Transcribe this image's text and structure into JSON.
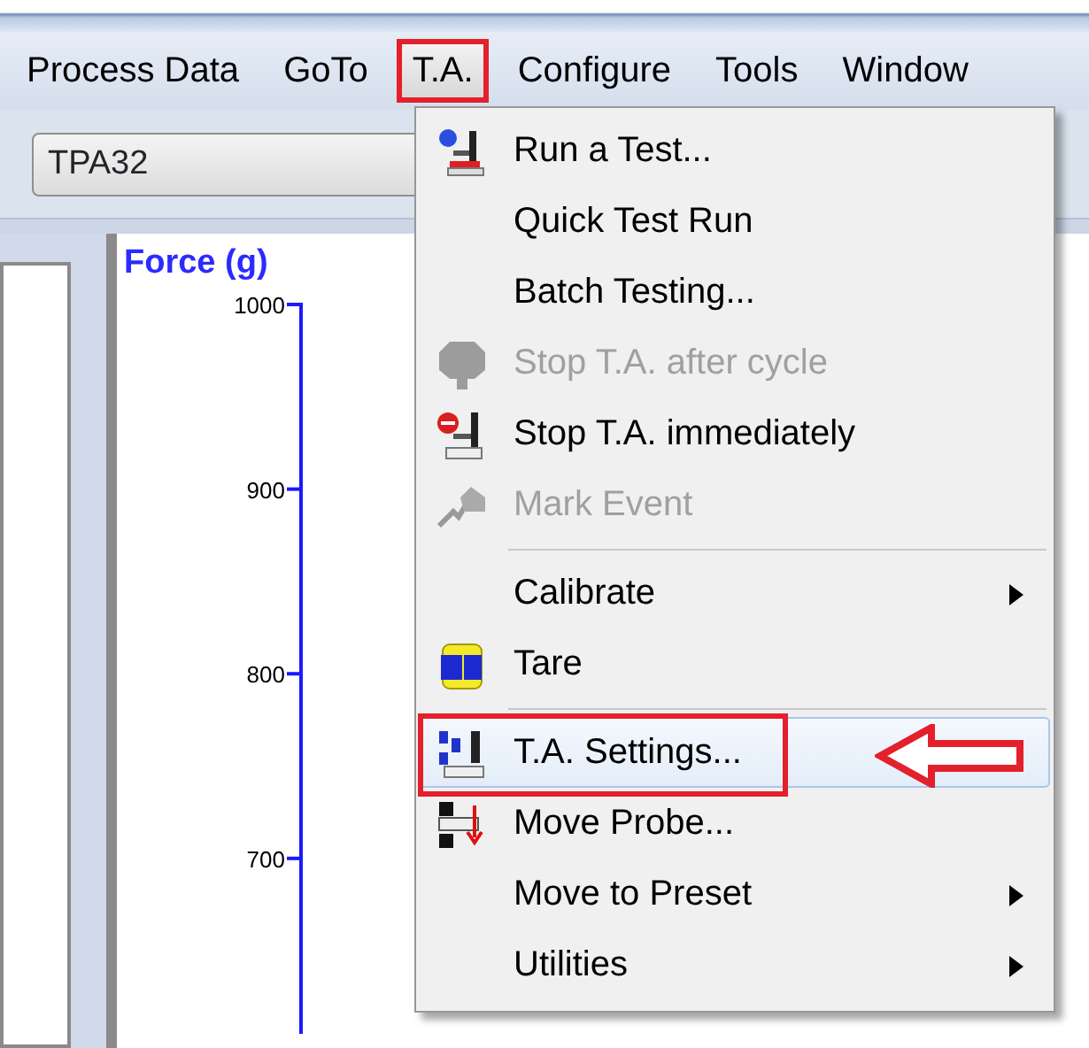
{
  "menu_bar": [
    {
      "label": "Process Data",
      "selected": false,
      "annotated": false
    },
    {
      "label": "GoTo",
      "selected": false,
      "annotated": false
    },
    {
      "label": "T.A.",
      "selected": true,
      "annotated": true
    },
    {
      "label": "Configure",
      "selected": false,
      "annotated": false
    },
    {
      "label": "Tools",
      "selected": false,
      "annotated": false
    },
    {
      "label": "Window",
      "selected": false,
      "annotated": false
    }
  ],
  "toolbar": {
    "combo_value": "TPA32"
  },
  "chart": {
    "axis_title": "Force (g)",
    "tick_labels": [
      "1000",
      "900",
      "800",
      "700"
    ]
  },
  "menu": {
    "entries": [
      {
        "kind": "item",
        "label": "Run a Test...",
        "disabled": false,
        "selected": false,
        "submenu": false,
        "annotated": false,
        "arrow": false
      },
      {
        "kind": "item",
        "label": "Quick Test Run",
        "disabled": false,
        "selected": false,
        "submenu": false,
        "annotated": false,
        "arrow": false
      },
      {
        "kind": "item",
        "label": "Batch Testing...",
        "disabled": false,
        "selected": false,
        "submenu": false,
        "annotated": false,
        "arrow": false
      },
      {
        "kind": "item",
        "label": "Stop T.A. after cycle",
        "disabled": true,
        "selected": false,
        "submenu": false,
        "annotated": false,
        "arrow": false
      },
      {
        "kind": "item",
        "label": "Stop T.A. immediately",
        "disabled": false,
        "selected": false,
        "submenu": false,
        "annotated": false,
        "arrow": false
      },
      {
        "kind": "item",
        "label": "Mark Event",
        "disabled": true,
        "selected": false,
        "submenu": false,
        "annotated": false,
        "arrow": false
      },
      {
        "kind": "separator"
      },
      {
        "kind": "item",
        "label": "Calibrate",
        "disabled": false,
        "selected": false,
        "submenu": true,
        "annotated": false,
        "arrow": false
      },
      {
        "kind": "item",
        "label": "Tare",
        "disabled": false,
        "selected": false,
        "submenu": false,
        "annotated": false,
        "arrow": false
      },
      {
        "kind": "separator"
      },
      {
        "kind": "item",
        "label": "T.A. Settings...",
        "disabled": false,
        "selected": true,
        "submenu": false,
        "annotated": true,
        "arrow": true
      },
      {
        "kind": "item",
        "label": "Move Probe...",
        "disabled": false,
        "selected": false,
        "submenu": false,
        "annotated": false,
        "arrow": false
      },
      {
        "kind": "item",
        "label": "Move to Preset",
        "disabled": false,
        "selected": false,
        "submenu": true,
        "annotated": false,
        "arrow": false
      },
      {
        "kind": "item",
        "label": "Utilities",
        "disabled": false,
        "selected": false,
        "submenu": true,
        "annotated": false,
        "arrow": false
      }
    ]
  }
}
